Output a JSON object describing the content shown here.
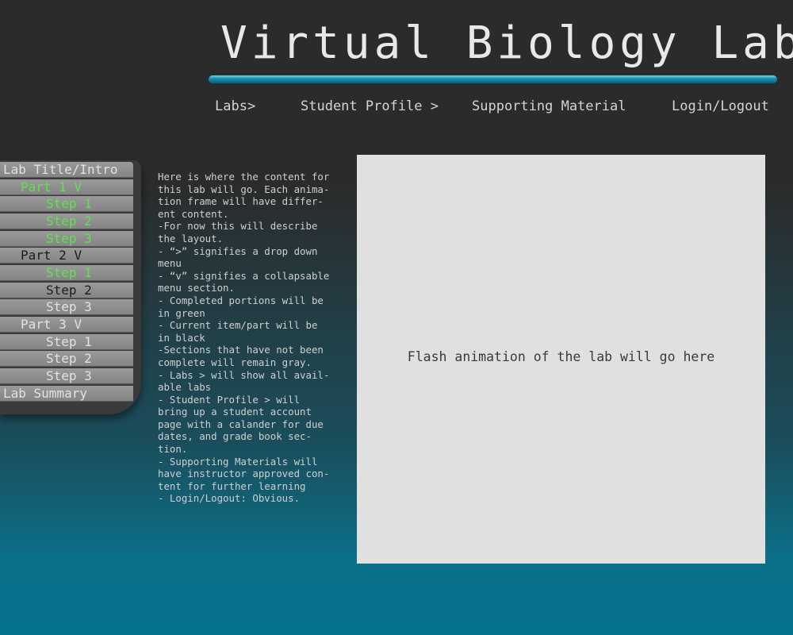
{
  "header": {
    "title": "Virtual Biology Lab",
    "nav": [
      "Labs>",
      "Student Profile >",
      "Supporting Material",
      "Login/Logout"
    ]
  },
  "sidebar": {
    "items": [
      {
        "label": "Lab Title/Intro",
        "state": "gray"
      },
      {
        "label": "Part 1 ",
        "toggle": "V",
        "state": "green"
      },
      {
        "label": "Step 1",
        "state": "green"
      },
      {
        "label": "Step 2",
        "state": "green"
      },
      {
        "label": "Step 3",
        "state": "green"
      },
      {
        "label": "Part 2 ",
        "toggle": "V",
        "state": "black"
      },
      {
        "label": "Step 1",
        "state": "green"
      },
      {
        "label": "Step 2",
        "state": "black"
      },
      {
        "label": "Step 3",
        "state": "gray"
      },
      {
        "label": "Part 3 ",
        "toggle": "V",
        "state": "gray"
      },
      {
        "label": "Step 1",
        "state": "gray"
      },
      {
        "label": "Step 2",
        "state": "gray"
      },
      {
        "label": "Step 3",
        "state": "gray"
      },
      {
        "label": "Lab Summary",
        "state": "gray"
      }
    ]
  },
  "description": {
    "lines": [
      "Here is where the content for",
      "this lab will go. Each anima-",
      "tion frame will have differ-",
      "ent content.",
      "-For now this will describe",
      "the layout.",
      "- “>” signifies a drop down",
      "menu",
      "- “v” signifies a collapsable",
      "menu section.",
      "- Completed portions will be",
      "in green",
      "- Current item/part will be",
      "in black",
      "-Sections that have not been",
      "complete will remain gray.",
      "- Labs > will show all avail-",
      "able labs",
      "- Student Profile > will",
      "bring up a student account",
      "page with a calander for due",
      "dates, and grade book sec-",
      "tion.",
      "- Supporting Materials will",
      "have instructor approved con-",
      "tent for further learning",
      "- Login/Logout: Obvious."
    ]
  },
  "flash": {
    "text": "Flash animation of the lab will go here"
  },
  "colors": {
    "completed": "#5fe34e",
    "current": "#1c1c1c",
    "pending": "#e2e2e2",
    "accent": "#1a8fb0"
  }
}
